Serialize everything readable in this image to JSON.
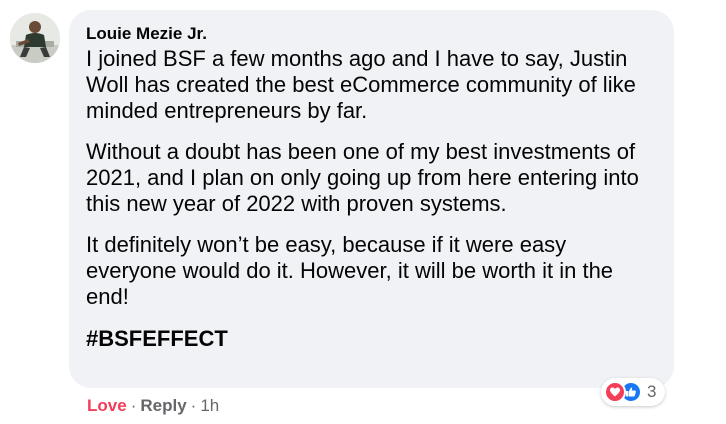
{
  "comment": {
    "author": "Louie Mezie Jr.",
    "paragraphs": [
      "I joined BSF a few months ago and I have to say, Justin Woll has created the best eCommerce community of like minded entrepreneurs by far.",
      "Without a doubt has been one of my best investments of 2021, and I plan on only going up from here entering into this new year of 2022 with proven systems.",
      "It definitely won’t be easy, because if it were easy everyone would do it. However, it will be worth it in the end!"
    ],
    "hashtag": "#BSFEFFECT"
  },
  "reactions": {
    "icons": [
      "heart-icon",
      "thumbs-up-icon"
    ],
    "count": "3",
    "colors": {
      "love": "#f33e58",
      "like": "#1877f2"
    }
  },
  "actions": {
    "love_label": "Love",
    "separator": "·",
    "reply_label": "Reply",
    "timestamp": "1h"
  },
  "colors": {
    "bubble": "#f0f2f5",
    "text": "#050505",
    "meta": "#65676b"
  }
}
